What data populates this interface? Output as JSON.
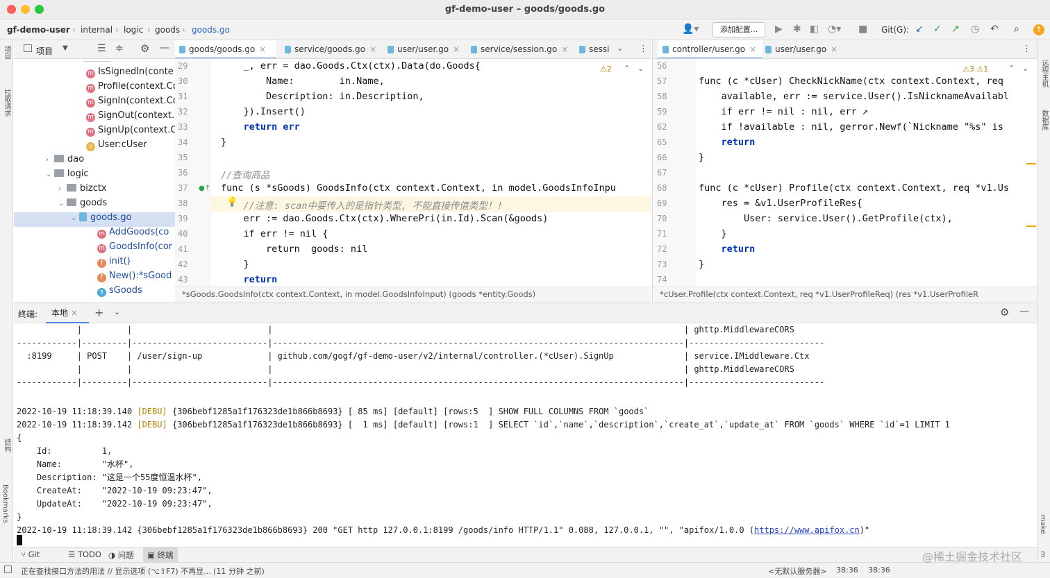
{
  "window": {
    "title": "gf-demo-user – goods/goods.go"
  },
  "breadcrumb": [
    "gf-demo-user",
    "internal",
    "logic",
    "goods",
    "goods.go"
  ],
  "toolbar": {
    "run_config": "添加配置...",
    "git_label": "Git(G):"
  },
  "project_panel": {
    "title": "项目"
  },
  "tree": [
    {
      "label": "IsSignedIn(conte",
      "icon": "method-icon"
    },
    {
      "label": "Profile(context.Co",
      "icon": "method-icon"
    },
    {
      "label": "SignIn(context.Co",
      "icon": "method-icon"
    },
    {
      "label": "SignOut(context.",
      "icon": "method-icon"
    },
    {
      "label": "SignUp(context.C",
      "icon": "method-icon"
    },
    {
      "label": "User:cUser",
      "icon": "var-icon"
    },
    {
      "label": "dao",
      "icon": "folder-icon"
    },
    {
      "label": "logic",
      "icon": "folder-icon"
    },
    {
      "label": "bizctx",
      "icon": "folder-icon"
    },
    {
      "label": "goods",
      "icon": "folder-icon"
    },
    {
      "label": "goods.go",
      "icon": "gofile-icon"
    },
    {
      "label": "AddGoods(co",
      "icon": "method-icon"
    },
    {
      "label": "GoodsInfo(cor",
      "icon": "method-icon"
    },
    {
      "label": "init()",
      "icon": "func-icon"
    },
    {
      "label": "New():*sGood",
      "icon": "func-icon"
    },
    {
      "label": "sGoods",
      "icon": "struct-icon"
    }
  ],
  "left_tabs": [
    {
      "label": "goods/goods.go"
    },
    {
      "label": "service/goods.go"
    },
    {
      "label": "user/user.go"
    },
    {
      "label": "service/session.go"
    },
    {
      "label": "sessi"
    }
  ],
  "right_tabs": [
    {
      "label": "controller/user.go"
    },
    {
      "label": "user/user.go"
    }
  ],
  "left_editor": {
    "line_numbers": [
      "29",
      "30",
      "31",
      "32",
      "33",
      "34",
      "35",
      "36",
      "37",
      "38",
      "39",
      "40",
      "41",
      "42",
      "43"
    ],
    "lines": [
      "    _, err = dao.Goods.Ctx(ctx).Data(do.Goods{",
      "        Name:        in.Name,",
      "        Description: in.Description,",
      "    }).Insert()",
      "    return err",
      "}",
      "",
      "//查询商品",
      "func (s *sGoods) GoodsInfo(ctx context.Context, in model.GoodsInfoInpu",
      "    //注意: scan中要传入的是指针类型, 不能直接传值类型！！",
      "    err := dao.Goods.Ctx(ctx).WherePri(in.Id).Scan(&goods)",
      "    if err != nil {",
      "        return  goods: nil",
      "    }",
      "    return"
    ],
    "warnings": "⚠2",
    "status": "*sGoods.GoodsInfo(ctx context.Context, in model.GoodsInfoInput) (goods *entity.Goods)"
  },
  "right_editor": {
    "line_numbers": [
      "56",
      "57",
      "58",
      "59",
      "62",
      "65",
      "66",
      "67",
      "68",
      "69",
      "70",
      "71",
      "72",
      "73",
      "74"
    ],
    "lines": [
      "",
      "func (c *cUser) CheckNickName(ctx context.Context, req",
      "    available, err := service.User().IsNicknameAvailabl",
      "    if err != nil : nil, err ↗",
      "    if !available : nil, gerror.Newf(`Nickname \"%s\" is",
      "    return",
      "}",
      "",
      "func (c *cUser) Profile(ctx context.Context, req *v1.Us",
      "    res = &v1.UserProfileRes{",
      "        User: service.User().GetProfile(ctx),",
      "    }",
      "    return",
      "}",
      ""
    ],
    "warnings": "⚠3 ⚠1",
    "status": "*cUser.Profile(ctx context.Context, req *v1.UserProfileReq) (res *v1.UserProfileR"
  },
  "terminal": {
    "label": "终端:",
    "tab": "本地",
    "lines": [
      "            |         |                           |                                                                                  | ghttp.MiddlewareCORS",
      "------------|---------|---------------------------|----------------------------------------------------------------------------------|---------------------------",
      "  :8199     | POST    | /user/sign-up             | github.com/gogf/gf-demo-user/v2/internal/controller.(*cUser).SignUp              | service.IMiddleware.Ctx",
      "            |         |                           |                                                                                  | ghttp.MiddlewareCORS",
      "------------|---------|---------------------------|----------------------------------------------------------------------------------|---------------------------",
      "",
      "",
      "2022-10-19 11:18:39.140 [DEBU] {306bebf1285a1f176323de1b866b8693} [ 85 ms] [default] [rows:5  ] SHOW FULL COLUMNS FROM `goods`",
      "2022-10-19 11:18:39.142 [DEBU] {306bebf1285a1f176323de1b866b8693} [  1 ms] [default] [rows:1  ] SELECT `id`,`name`,`description`,`create_at`,`update_at` FROM `goods` WHERE `id`=1 LIMIT 1",
      "{",
      "    Id:          1,",
      "    Name:        \"水杯\",",
      "    Description: \"这是一个55度恒温水杯\",",
      "    CreateAt:    \"2022-10-19 09:23:47\",",
      "    UpdateAt:    \"2022-10-19 09:23:47\",",
      "}",
      "2022-10-19 11:18:39.142 {306bebf1285a1f176323de1b866b8693} 200 \"GET http 127.0.0.1:8199 /goods/info HTTP/1.1\" 0.088, 127.0.0.1, \"\", \"apifox/1.0.0 (https://www.apifox.cn)\""
    ]
  },
  "bottom_tabs": [
    "Git",
    "TODO",
    "问题",
    "终端"
  ],
  "statusbar": {
    "left": "正在查找接口方法的用法 // 显示选项 (⌥⇧F7)   不再显... (11 分钟 之前)",
    "server": "<无默认服务器>",
    "pos1": "38:36",
    "pos2": "38:36",
    "watermark": "@稀土掘金技术社区"
  },
  "side_labels": {
    "project": "项目",
    "pull": "拉取请求",
    "structure": "结构",
    "bookmarks": "Bookmarks",
    "remote": "远程主机",
    "database": "数据库",
    "make": "make",
    "m": "m"
  }
}
